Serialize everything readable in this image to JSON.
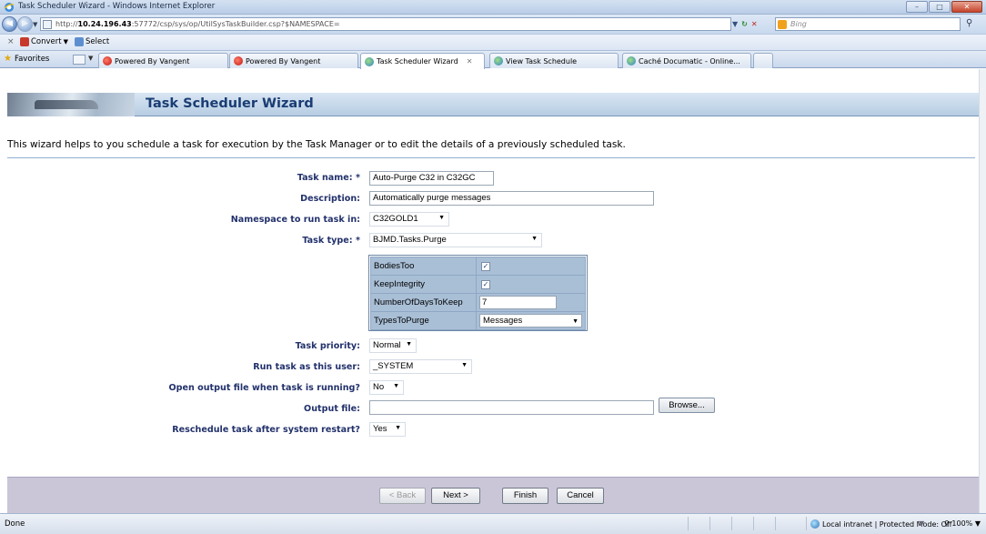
{
  "window": {
    "title": "Task Scheduler Wizard - Windows Internet Explorer"
  },
  "addressbar": {
    "url_prefix": "http://",
    "url_host": "10.24.196.43",
    "url_rest": ":57772/csp/sys/op/UtilSysTaskBuilder.csp?$NAMESPACE=",
    "search_placeholder": "Bing"
  },
  "commandbar": {
    "convert_label": "Convert",
    "select_label": "Select"
  },
  "tabs": {
    "favorites_label": "Favorites",
    "items": [
      {
        "label": "Powered By Vangent"
      },
      {
        "label": "Powered By Vangent"
      },
      {
        "label": "Task Scheduler Wizard"
      },
      {
        "label": "View Task Schedule"
      },
      {
        "label": "Caché Documatic - Online..."
      }
    ]
  },
  "page": {
    "heading": "Task Scheduler Wizard",
    "intro": "This wizard helps to you schedule a task for execution by the Task Manager or to edit the details of a previously scheduled task."
  },
  "form": {
    "required_mark": "*",
    "task_name": {
      "label": "Task name:",
      "value": "Auto-Purge C32 in C32GC"
    },
    "description": {
      "label": "Description:",
      "value": "Automatically purge messages"
    },
    "namespace": {
      "label": "Namespace to run task in:",
      "value": "C32GOLD1"
    },
    "task_type": {
      "label": "Task type:",
      "value": "BJMD.Tasks.Purge"
    },
    "settings": [
      {
        "name": "BodiesToo",
        "kind": "checkbox",
        "value": "✓"
      },
      {
        "name": "KeepIntegrity",
        "kind": "checkbox",
        "value": "✓"
      },
      {
        "name": "NumberOfDaysToKeep",
        "kind": "text",
        "value": "7"
      },
      {
        "name": "TypesToPurge",
        "kind": "select",
        "value": "Messages"
      }
    ],
    "priority": {
      "label": "Task priority:",
      "value": "Normal"
    },
    "run_as": {
      "label": "Run task as this user:",
      "value": "_SYSTEM"
    },
    "open_output": {
      "label": "Open output file when task is running?",
      "value": "No"
    },
    "output_file": {
      "label": "Output file:",
      "value": "",
      "browse_label": "Browse..."
    },
    "reschedule": {
      "label": "Reschedule task after system restart?",
      "value": "Yes"
    }
  },
  "buttons": {
    "back": "< Back",
    "next": "Next >",
    "finish": "Finish",
    "cancel": "Cancel"
  },
  "statusbar": {
    "status": "Done",
    "zone": "Local intranet | Protected Mode: Off",
    "zoom": "100%"
  },
  "colors": {
    "heading": "#1a3d73",
    "label": "#22316b",
    "footer": "#cac6d8",
    "settings_cell": "#a9bfd6"
  }
}
